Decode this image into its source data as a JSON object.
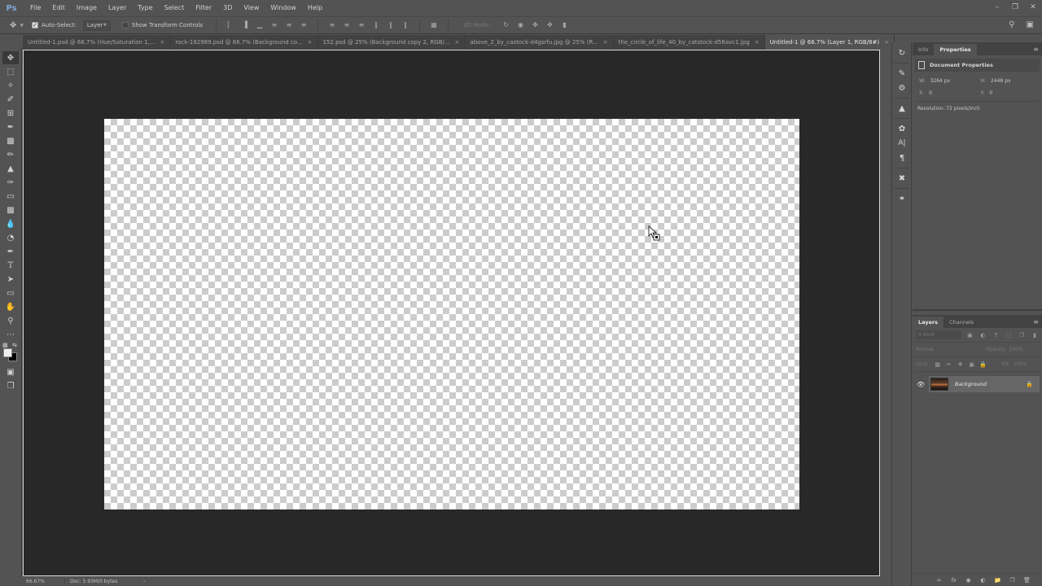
{
  "app": {
    "logo": "Ps",
    "menu": [
      "File",
      "Edit",
      "Image",
      "Layer",
      "Type",
      "Select",
      "Filter",
      "3D",
      "View",
      "Window",
      "Help"
    ],
    "window_controls": [
      "minimize-icon",
      "restore-icon",
      "close-icon"
    ]
  },
  "options_bar": {
    "tool_icon": "move-icon",
    "auto_select_checked": true,
    "auto_select_label": "Auto-Select:",
    "auto_select_target": "Layer",
    "show_transform_checked": false,
    "show_transform_label": "Show Transform Controls",
    "align_icons": [
      "align-top",
      "align-vcenter",
      "align-bottom",
      "align-left",
      "align-hcenter",
      "align-right"
    ],
    "distribute_icons": [
      "distribute-top",
      "distribute-vcenter",
      "distribute-bottom",
      "distribute-left",
      "distribute-hcenter",
      "distribute-right"
    ],
    "auto_align_icon": "auto-align-icon",
    "mode_3d_label": "3D Mode:",
    "mode_3d_icons": [
      "orbit-3d",
      "roll-3d",
      "pan-3d",
      "slide-3d",
      "scale-3d"
    ],
    "right_icons": [
      "search-icon",
      "workspace-icon"
    ]
  },
  "tabs": [
    {
      "label": "Untitled-1.psd @ 66.7% (Hue/Saturation 1,...",
      "active": false
    },
    {
      "label": "rock-192989.psd @ 66.7% (Background co...",
      "active": false
    },
    {
      "label": "152.psd @ 25% (Background copy 2, RGB/...",
      "active": false
    },
    {
      "label": "above_2_by_castock-d4gsrfu.jpg @ 25% (R...",
      "active": false
    },
    {
      "label": "the_circle_of_life_40_by_catstock-d56avc1.jpg",
      "active": false
    },
    {
      "label": "Untitled-1 @ 66.7% (Layer 1, RGB/8#)",
      "active": true
    }
  ],
  "tab_close_glyph": "×",
  "tools": [
    "move-tool",
    "marquee-tool",
    "lasso-tool",
    "quick-select-tool",
    "crop-tool",
    "eyedropper-tool",
    "healing-brush-tool",
    "brush-tool",
    "clone-stamp-tool",
    "history-brush-tool",
    "eraser-tool",
    "gradient-tool",
    "blur-tool",
    "dodge-tool",
    "pen-tool",
    "type-tool",
    "path-select-tool",
    "rectangle-tool",
    "hand-tool",
    "zoom-tool",
    "more-tools"
  ],
  "colors": {
    "foreground": "#f0f0f0",
    "background": "#000000"
  },
  "status": {
    "zoom": "66.67%",
    "doc": "Doc: 5.93M/0 bytes",
    "arrow": "›"
  },
  "dock_icons": [
    "history-icon",
    "brush-preset-icon",
    "adjustments-icon",
    "clone-source-icon",
    "brush-icon",
    "character-icon",
    "paragraph-icon",
    "tool-presets-icon",
    "libraries-icon"
  ],
  "properties": {
    "tabs": [
      "Info",
      "Properties"
    ],
    "active_tab": "Properties",
    "header": "Document Properties",
    "w_label": "W:",
    "w_value": "3264 px",
    "h_label": "H:",
    "h_value": "2448 px",
    "x_label": "X:",
    "x_value": "0",
    "y_label": "Y:",
    "y_value": "0",
    "resolution": "Resolution: 72 pixels/inch"
  },
  "layers": {
    "tabs": [
      "Layers",
      "Channels"
    ],
    "active_tab": "Layers",
    "filter_placeholder": "Kind",
    "blend_mode": "Normal",
    "opacity_label": "Opacity:",
    "opacity_value": "100%",
    "lock_label": "Lock:",
    "fill_label": "Fill:",
    "fill_value": "100%",
    "items": [
      {
        "name": "Background",
        "visible": true,
        "locked": true
      }
    ],
    "footer_icons": [
      "link-icon",
      "fx-icon",
      "mask-icon",
      "adjustment-layer-icon",
      "group-icon",
      "new-layer-icon",
      "delete-icon"
    ]
  }
}
